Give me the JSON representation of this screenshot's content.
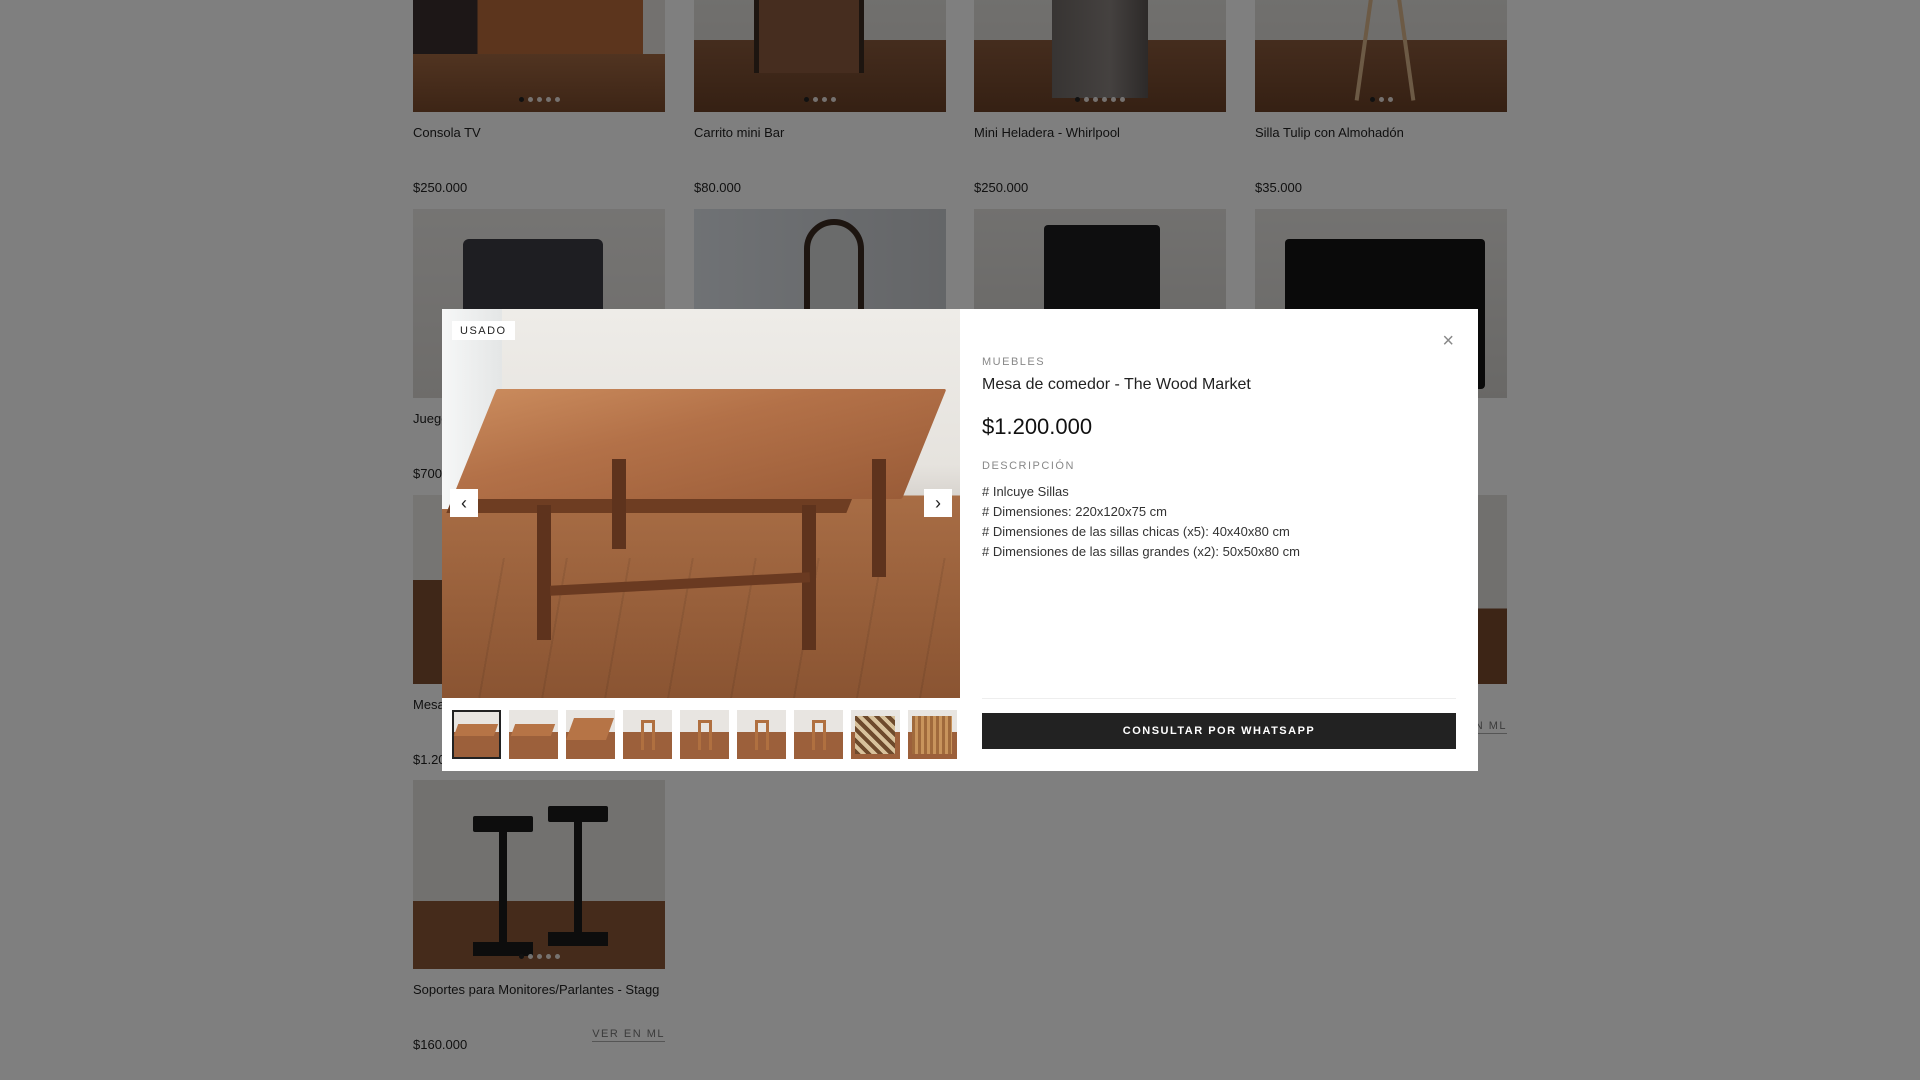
{
  "products": [
    {
      "name": "Consola TV",
      "price": "$250.000",
      "ml": ""
    },
    {
      "name": "Carrito mini Bar",
      "price": "$80.000",
      "ml": ""
    },
    {
      "name": "Mini Heladera - Whirlpool",
      "price": "$250.000",
      "ml": ""
    },
    {
      "name": "Silla Tulip con Almohadón",
      "price": "$35.000",
      "ml": ""
    },
    {
      "name": "Juego",
      "price": "$700",
      "ml": ""
    },
    {
      "name": "Mesa",
      "price": "$1.20",
      "ml": ""
    },
    {
      "name": "",
      "price": "",
      "ml": "N ML"
    },
    {
      "name": "Soportes para Monitores/Parlantes - Stagg",
      "price": "$160.000",
      "ml": "VER EN ML"
    }
  ],
  "modal": {
    "badge": "USADO",
    "category": "MUEBLES",
    "title": "Mesa de comedor - The Wood Market",
    "price": "$1.200.000",
    "description_label": "DESCRIPCIÓN",
    "description": [
      "# Inlcuye Sillas",
      "# Dimensiones: 220x120x75 cm",
      "# Dimensiones de las sillas chicas (x5): 40x40x80 cm",
      "# Dimensiones de las sillas grandes (x2): 50x50x80 cm"
    ],
    "cta": "CONSULTAR POR WHATSAPP",
    "close_icon": "×",
    "prev_icon": "‹",
    "next_icon": "›"
  },
  "colors": {
    "overlay": "rgba(0,0,0,0.5)",
    "button": "#222222",
    "text": "#222222",
    "muted": "#888888"
  }
}
